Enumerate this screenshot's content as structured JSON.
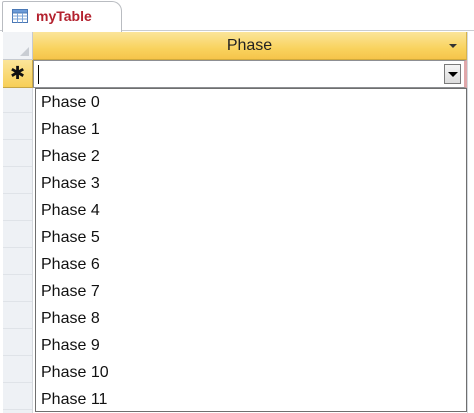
{
  "tab": {
    "title": "myTable",
    "icon": "table-icon"
  },
  "grid": {
    "column_header": "Phase",
    "new_record_marker": "✱",
    "current_value": ""
  },
  "dropdown": {
    "items": [
      "Phase 0",
      "Phase 1",
      "Phase 2",
      "Phase 3",
      "Phase 4",
      "Phase 5",
      "Phase 6",
      "Phase 7",
      "Phase 8",
      "Phase 9",
      "Phase 10",
      "Phase 11"
    ]
  },
  "colors": {
    "tab_title": "#b3212e",
    "header_gold": "#f9d35f",
    "selector_bg": "#eef1f5"
  }
}
